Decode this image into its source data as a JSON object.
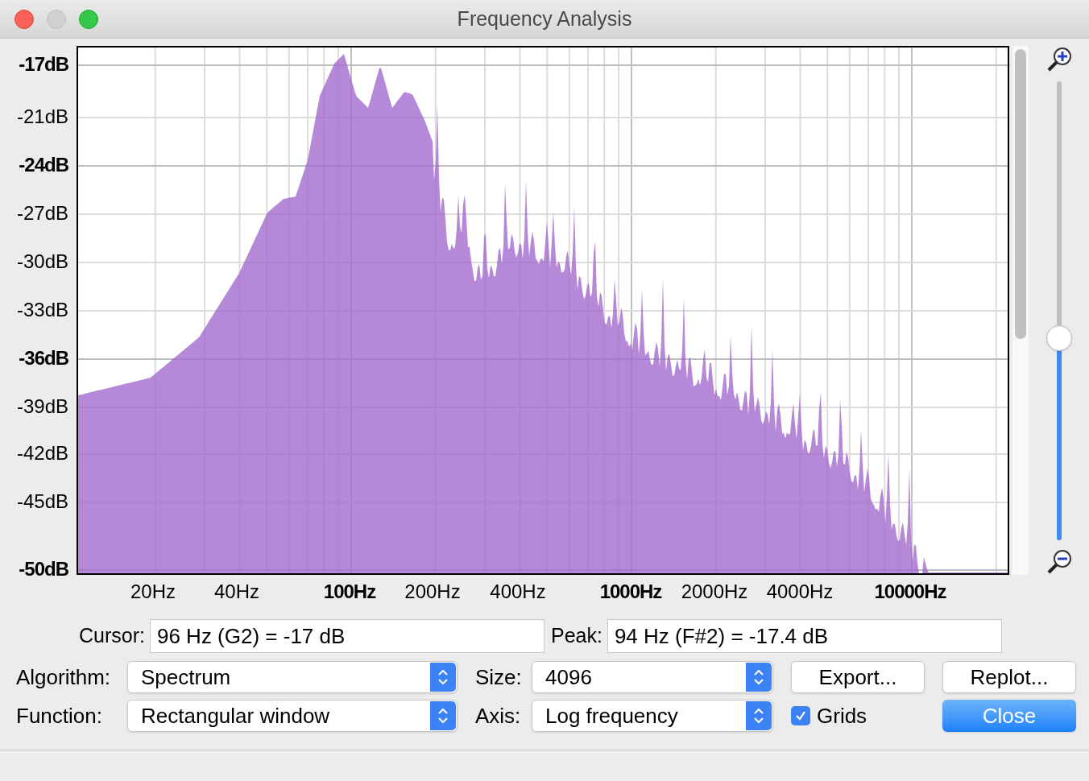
{
  "window": {
    "title": "Frequency Analysis"
  },
  "plot": {
    "y_labels": [
      {
        "text": "-17dB",
        "major": true
      },
      {
        "text": "-21dB",
        "major": false
      },
      {
        "text": "-24dB",
        "major": true
      },
      {
        "text": "-27dB",
        "major": false
      },
      {
        "text": "-30dB",
        "major": false
      },
      {
        "text": "-33dB",
        "major": false
      },
      {
        "text": "-36dB",
        "major": true
      },
      {
        "text": "-39dB",
        "major": false
      },
      {
        "text": "-42dB",
        "major": false
      },
      {
        "text": "-45dB",
        "major": false
      },
      {
        "text": "-50dB",
        "major": true
      }
    ],
    "x_labels": [
      {
        "text": "20Hz",
        "major": false
      },
      {
        "text": "40Hz",
        "major": false
      },
      {
        "text": "100Hz",
        "major": true
      },
      {
        "text": "200Hz",
        "major": false
      },
      {
        "text": "400Hz",
        "major": false
      },
      {
        "text": "1000Hz",
        "major": true
      },
      {
        "text": "2000Hz",
        "major": false
      },
      {
        "text": "4000Hz",
        "major": false
      },
      {
        "text": "10000Hz",
        "major": true
      }
    ]
  },
  "zoom": {
    "level": 0.44
  },
  "readouts": [
    {
      "label": "Cursor:",
      "value": "96 Hz (G2) = -17 dB"
    },
    {
      "label": "Peak:",
      "value": "94 Hz (F#2) = -17.4 dB"
    }
  ],
  "control_rows": [
    [
      {
        "kind": "select",
        "label": "Algorithm:",
        "value": "Spectrum"
      },
      {
        "kind": "select",
        "label": "Size:",
        "value": "4096"
      },
      {
        "kind": "button",
        "label": "Export...",
        "primary": false
      },
      {
        "kind": "button",
        "label": "Replot...",
        "primary": false
      }
    ],
    [
      {
        "kind": "select",
        "label": "Function:",
        "value": "Rectangular window"
      },
      {
        "kind": "select",
        "label": "Axis:",
        "value": "Log frequency"
      },
      {
        "kind": "checkbox",
        "label": "Grids",
        "checked": true
      },
      {
        "kind": "button",
        "label": "Close",
        "primary": true
      }
    ]
  ]
}
